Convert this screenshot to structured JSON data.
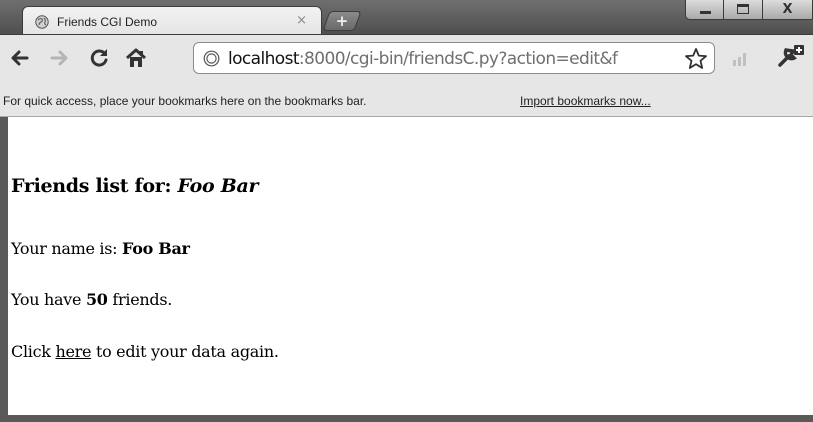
{
  "tab": {
    "title": "Friends CGI Demo",
    "close_glyph": "×",
    "new_tab_glyph": "+"
  },
  "window_controls": {
    "close_glyph": "X"
  },
  "toolbar": {
    "url_host": "localhost",
    "url_rest": ":8000/cgi-bin/friendsC.py?action=edit&f"
  },
  "bookmarks_bar": {
    "message": "For quick access, place your bookmarks here on the bookmarks bar.",
    "import_link": "Import bookmarks now..."
  },
  "page": {
    "heading_prefix": "Friends list for:",
    "heading_name": "Foo Bar",
    "name_prefix": "Your name is:",
    "name_value": "Foo Bar",
    "friends_prefix": "You have",
    "friends_count": "50",
    "friends_suffix": "friends.",
    "click_prefix": "Click",
    "click_link": "here",
    "click_suffix": "to edit your data again."
  },
  "icons": {
    "favicon": "globe-icon",
    "back": "back-arrow-icon",
    "forward": "forward-arrow-icon",
    "reload": "reload-icon",
    "home": "home-icon",
    "page_info": "globe-icon",
    "bookmark_star": "star-icon",
    "pagerank": "signal-bars-icon",
    "wrench": "wrench-icon"
  },
  "colors": {
    "frame": "#5a5a5a",
    "toolbar": "#e6e6e6",
    "link": "#000000"
  }
}
